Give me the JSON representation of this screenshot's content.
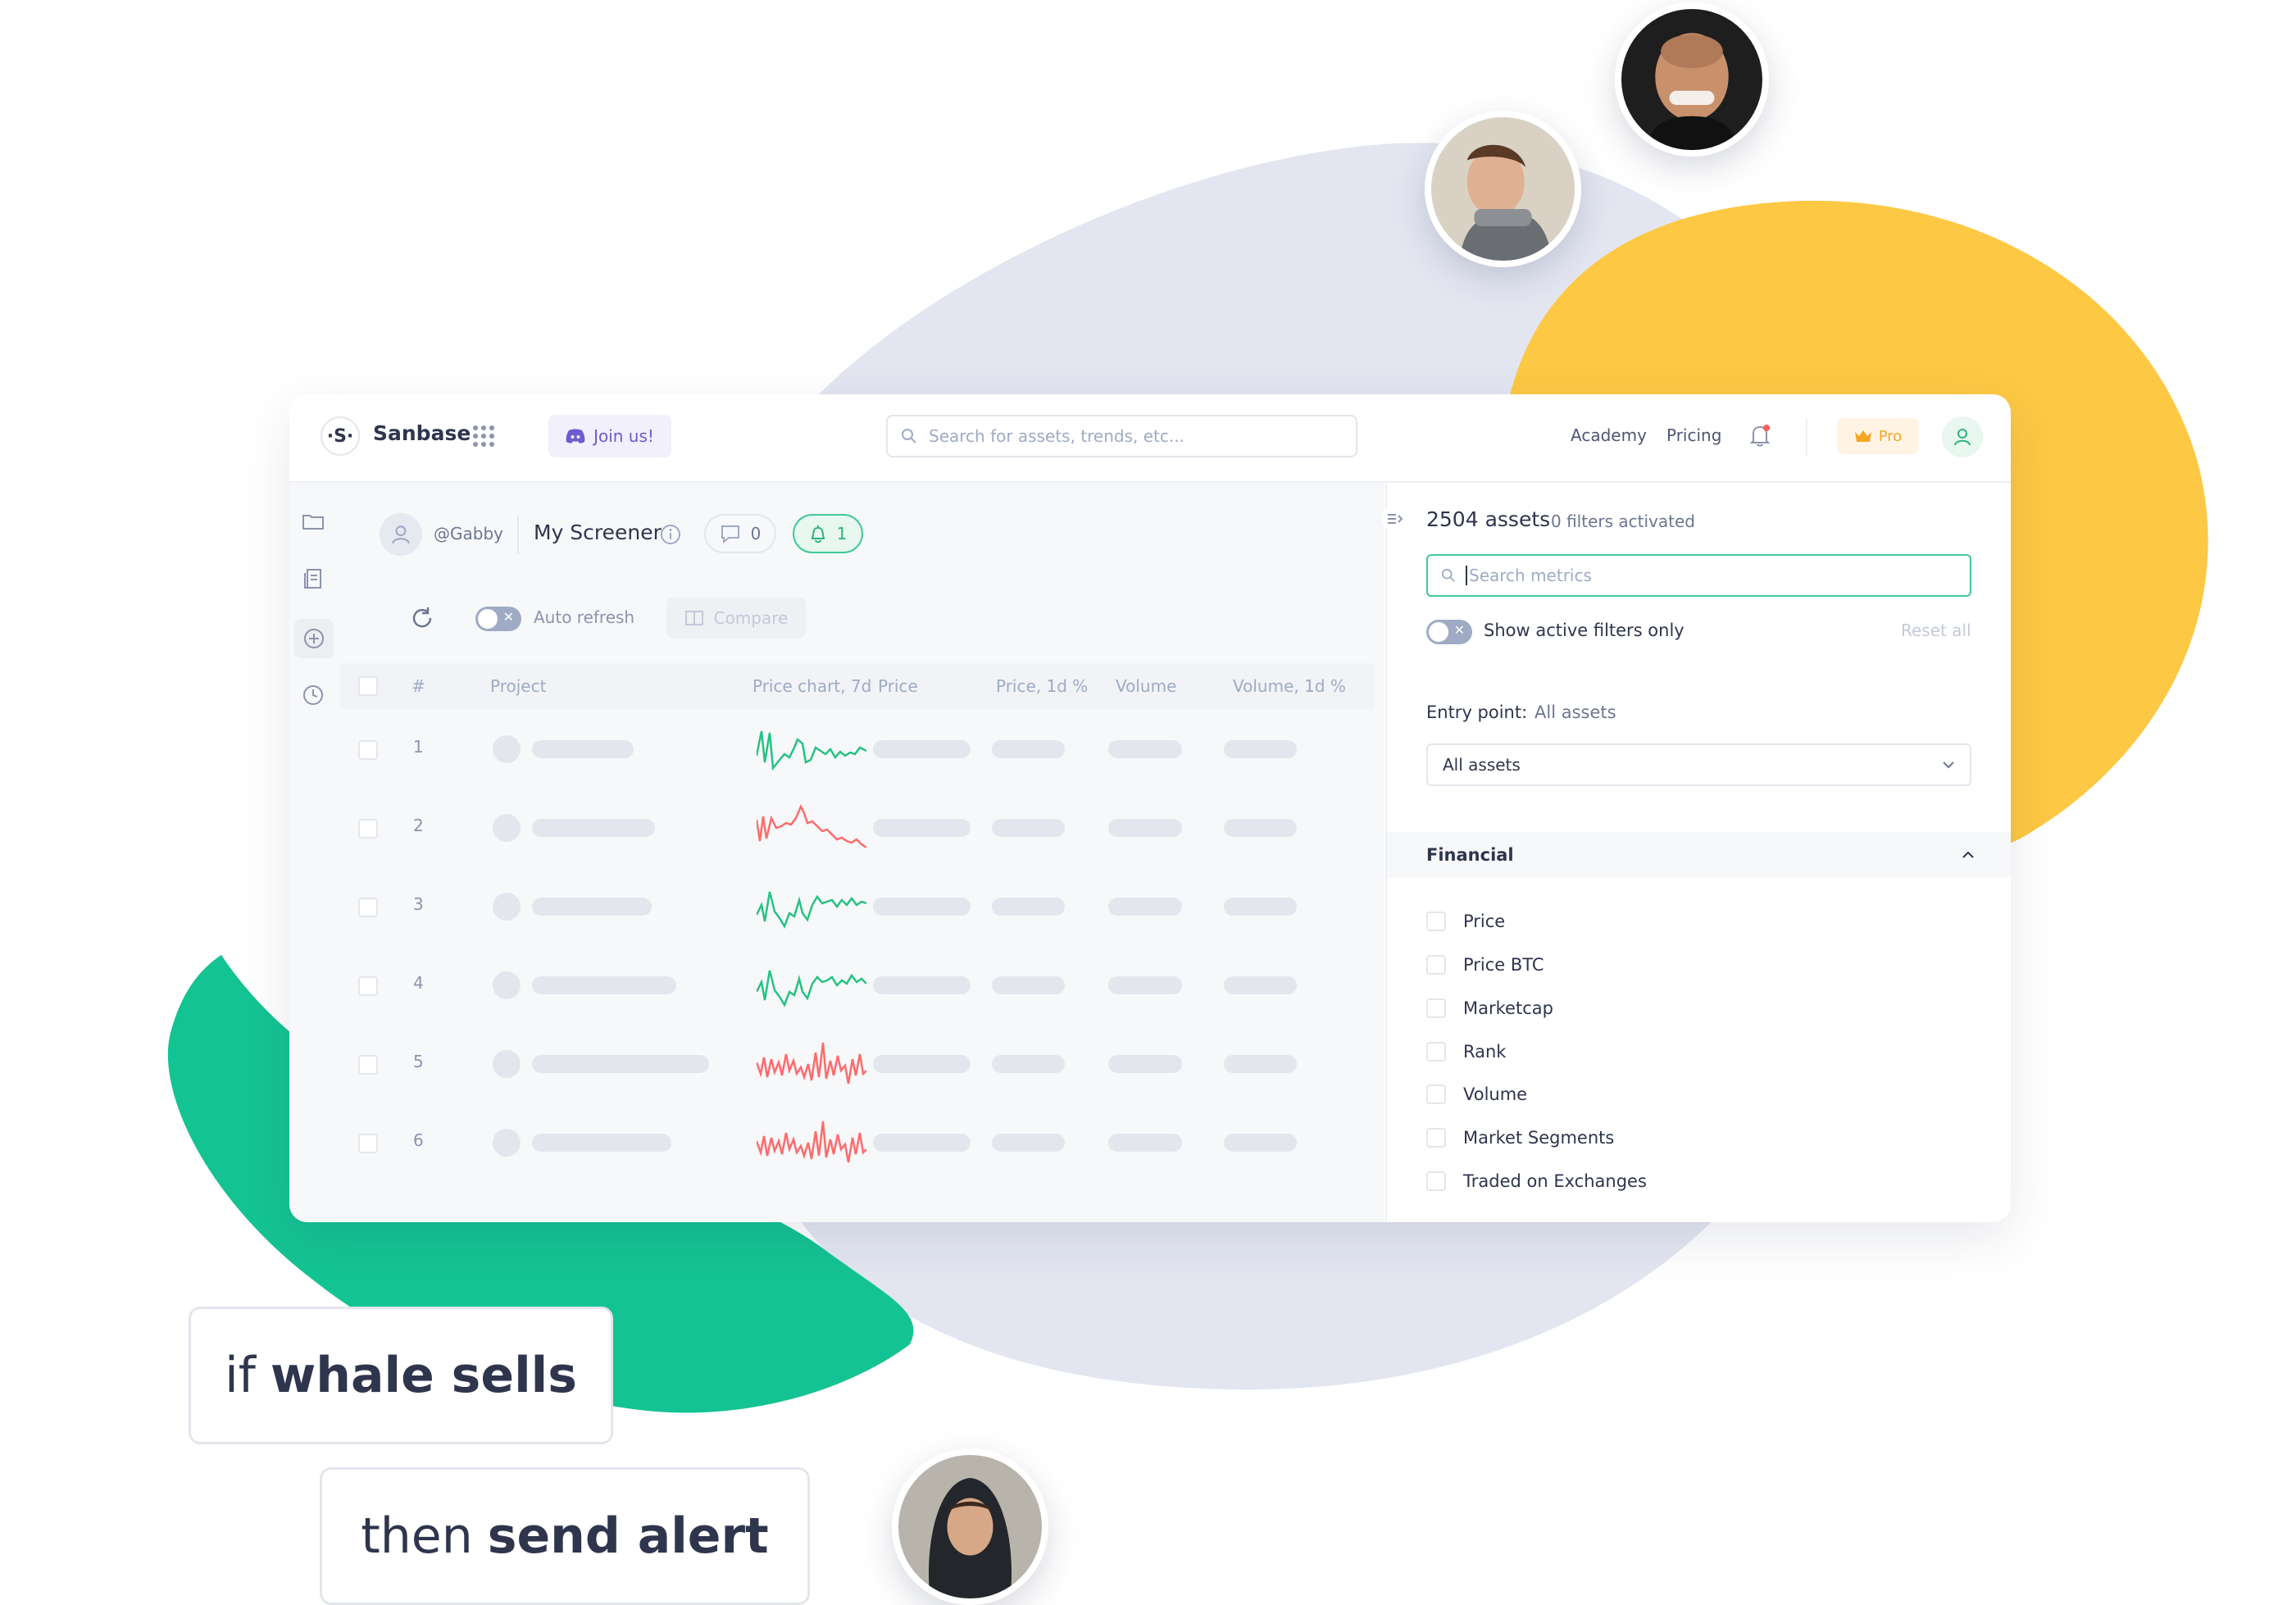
{
  "colors": {
    "gray_blob": "#e3e6f1",
    "yellow_blob": "#fdc843",
    "green_blob": "#14c393",
    "accent_green": "#3ec997",
    "text_dark": "#2f354d",
    "spark_green": "#26c281",
    "spark_red": "#ff5b5b"
  },
  "topbar": {
    "brand": "Sanbase",
    "logo_glyph": "·S·",
    "join_label": "Join us!",
    "search_placeholder": "Search for assets, trends, etc...",
    "nav_academy": "Academy",
    "nav_pricing": "Pricing",
    "pro_label": "Pro",
    "icons": [
      "apps-grid-icon",
      "discord-icon",
      "search-icon",
      "bell-icon",
      "crown-icon",
      "user-icon"
    ]
  },
  "sidebar": {
    "icons": [
      "folder-icon",
      "document-icon",
      "plus-circle-icon",
      "clock-icon"
    ]
  },
  "screener": {
    "username": "@Gabby",
    "title": "My Screener",
    "comments_count": "0",
    "alerts_count": "1",
    "auto_refresh_label": "Auto refresh",
    "compare_label": "Compare"
  },
  "table": {
    "headers": [
      "#",
      "Project",
      "Price chart, 7d",
      "Price",
      "Price, 1d %",
      "Volume",
      "Volume, 1d %"
    ],
    "rows": [
      {
        "num": "1",
        "trend": "up"
      },
      {
        "num": "2",
        "trend": "down"
      },
      {
        "num": "3",
        "trend": "up"
      },
      {
        "num": "4",
        "trend": "up"
      },
      {
        "num": "5",
        "trend": "down"
      },
      {
        "num": "6",
        "trend": "down"
      }
    ]
  },
  "filters": {
    "assets_count": "2504 assets",
    "filters_activated": "0 filters activated",
    "metrics_placeholder": "Search metrics",
    "show_active_label": "Show active filters only",
    "reset_label": "Reset all",
    "entry_point_label": "Entry point:",
    "entry_point_value": "All assets",
    "entry_select_value": "All assets",
    "section_title": "Financial",
    "metrics": [
      "Price",
      "Price BTC",
      "Marketcap",
      "Rank",
      "Volume",
      "Market Segments",
      "Traded on Exchanges"
    ]
  },
  "cards": {
    "if_word": "if",
    "if_bold": "whale sells",
    "then_word": "then",
    "then_bold": "send alert"
  }
}
